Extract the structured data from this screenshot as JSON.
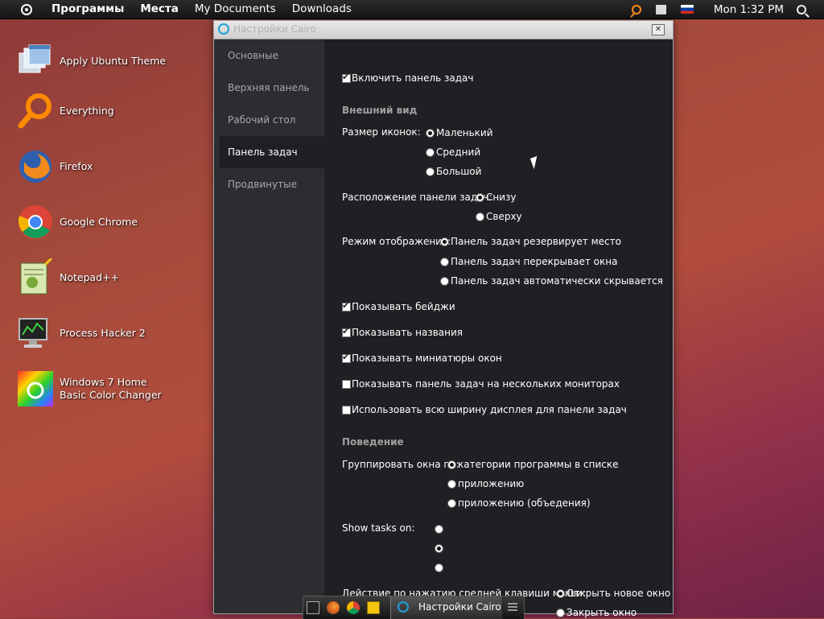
{
  "topbar": {
    "menu": [
      "Программы",
      "Места",
      "My Documents",
      "Downloads"
    ],
    "clock": "Mon 1:32 PM"
  },
  "desktop_icons": [
    {
      "label": "Apply Ubuntu Theme",
      "icon": "theme-icon"
    },
    {
      "label": "Everything",
      "icon": "search-icon"
    },
    {
      "label": "Firefox",
      "icon": "firefox-icon"
    },
    {
      "label": "Google Chrome",
      "icon": "chrome-icon"
    },
    {
      "label": "Notepad++",
      "icon": "notepad-icon"
    },
    {
      "label": "Process Hacker 2",
      "icon": "monitor-icon"
    },
    {
      "label": "Windows 7 Home Basic Color Changer",
      "icon": "color-wheel-icon"
    }
  ],
  "dialog": {
    "title": "Настройки Cairo",
    "sidebar": [
      "Основные",
      "Верхняя панель",
      "Рабочий стол",
      "Панель задач",
      "Продвинутые"
    ],
    "active_tab": "Панель задач",
    "enable_taskbar": {
      "label": "Включить панель задач",
      "checked": true
    },
    "appearance_header": "Внешний вид",
    "icon_size": {
      "label": "Размер иконок:",
      "options": [
        "Маленький",
        "Средний",
        "Большой"
      ],
      "selected": "Маленький"
    },
    "position": {
      "label": "Расположение панели задач:",
      "options": [
        "Снизу",
        "Сверху"
      ],
      "selected": "Снизу"
    },
    "display_mode": {
      "label": "Режим отображения:",
      "options": [
        "Панель задач резервирует место",
        "Панель задач перекрывает окна",
        "Панель задач автоматически скрывается"
      ],
      "selected": "Панель задач резервирует место"
    },
    "checkboxes": [
      {
        "label": "Показывать бейджи",
        "checked": true
      },
      {
        "label": "Показывать названия",
        "checked": true
      },
      {
        "label": "Показывать миниатюры окон",
        "checked": true
      },
      {
        "label": "Показывать панель задач на нескольких мониторах",
        "checked": false
      },
      {
        "label": "Использовать всю ширину дисплея для панели задач",
        "checked": false
      }
    ],
    "behavior_header": "Поведение",
    "group_by": {
      "label": "Группировать окна по:",
      "options": [
        "категории программы в списке",
        "приложению",
        "приложению (объедения)"
      ],
      "selected": "категории программы в списке"
    },
    "show_tasks_on": {
      "label": "Show tasks on:",
      "selected_index": 1
    },
    "middle_click": {
      "label": "Действие по нажатию средней клавиши мыши:",
      "options": [
        "Открыть новое окно",
        "Закрыть окно"
      ],
      "selected": "Открыть новое окно"
    }
  },
  "dock": {
    "task_label": "Настройки Cairo"
  }
}
